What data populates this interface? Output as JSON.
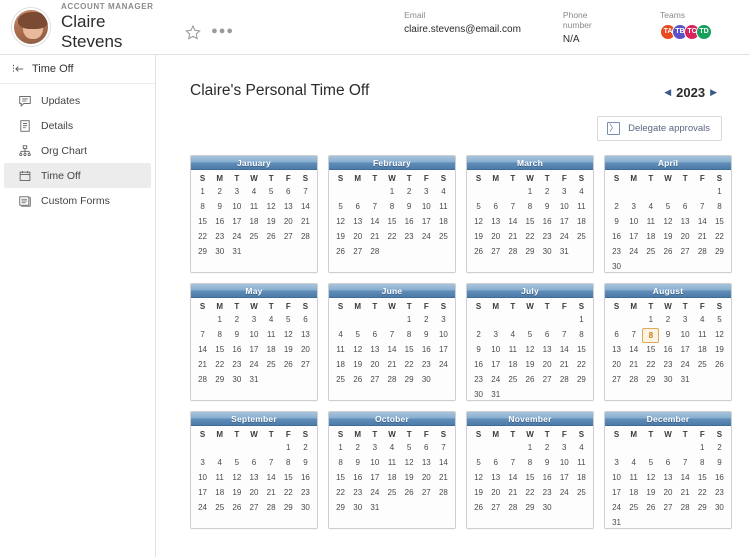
{
  "header": {
    "role": "ACCOUNT MANAGER",
    "name": "Claire Stevens",
    "star_icon": "star-icon",
    "more_icon": "more-options-icon",
    "meta": [
      {
        "label": "Email",
        "value": "claire.stevens@email.com"
      },
      {
        "label": "Phone number",
        "value": "N/A"
      }
    ],
    "teams_label": "Teams",
    "team_avatars": [
      {
        "color": "#e8491f",
        "initials": "TA"
      },
      {
        "color": "#5a52c8",
        "initials": "TB"
      },
      {
        "color": "#d8245c",
        "initials": "TC"
      },
      {
        "color": "#16a05c",
        "initials": "TD"
      }
    ]
  },
  "sidebar": {
    "collapse_label": "Time Off",
    "items": [
      {
        "label": "Updates",
        "icon": "comment-icon",
        "active": false
      },
      {
        "label": "Details",
        "icon": "document-icon",
        "active": false
      },
      {
        "label": "Org Chart",
        "icon": "org-chart-icon",
        "active": false
      },
      {
        "label": "Time Off",
        "icon": "calendar-icon",
        "active": true
      },
      {
        "label": "Custom Forms",
        "icon": "forms-icon",
        "active": false
      }
    ]
  },
  "main": {
    "title": "Claire's Personal Time Off",
    "year": "2023",
    "prev_arrow": "◀",
    "next_arrow": "▶",
    "delegate_label": "Delegate approvals",
    "delegate_icon": "〉",
    "dow": [
      "S",
      "M",
      "T",
      "W",
      "T",
      "F",
      "S"
    ],
    "today": {
      "month": "August",
      "day": 8
    },
    "months": [
      {
        "name": "January",
        "start": 0,
        "days": 31
      },
      {
        "name": "February",
        "start": 3,
        "days": 28
      },
      {
        "name": "March",
        "start": 3,
        "days": 31
      },
      {
        "name": "April",
        "start": 6,
        "days": 30
      },
      {
        "name": "May",
        "start": 1,
        "days": 31
      },
      {
        "name": "June",
        "start": 4,
        "days": 30
      },
      {
        "name": "July",
        "start": 6,
        "days": 31
      },
      {
        "name": "August",
        "start": 2,
        "days": 31
      },
      {
        "name": "September",
        "start": 5,
        "days": 30
      },
      {
        "name": "October",
        "start": 0,
        "days": 31
      },
      {
        "name": "November",
        "start": 3,
        "days": 30
      },
      {
        "name": "December",
        "start": 5,
        "days": 31
      }
    ]
  }
}
